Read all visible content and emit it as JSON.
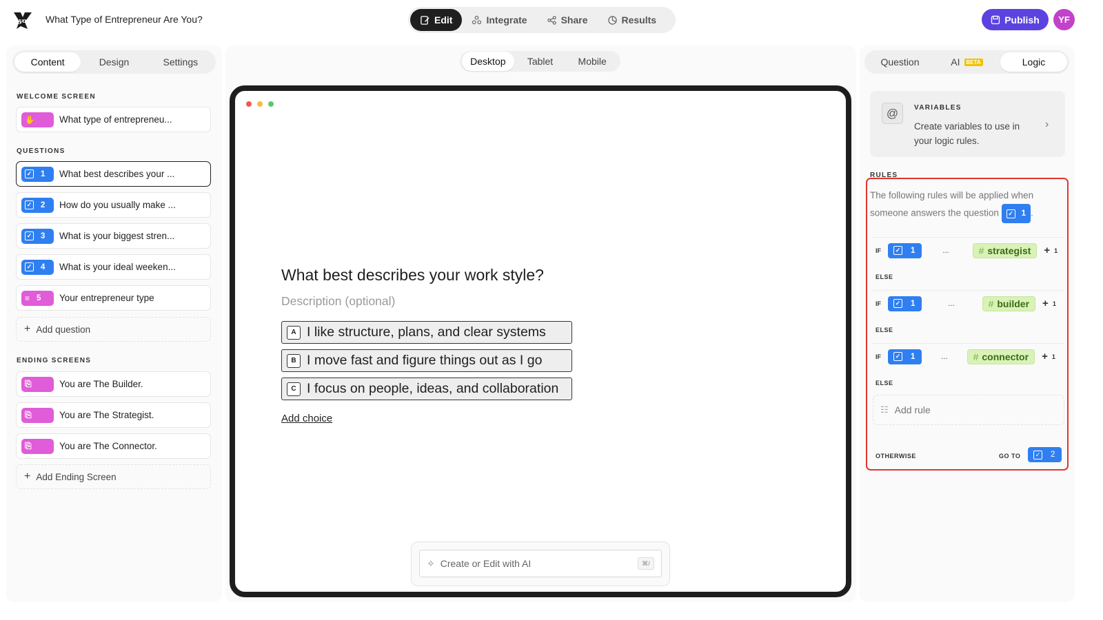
{
  "app": {
    "doc_title": "What Type of Entrepreneur Are You?",
    "logo": "logo-glyph"
  },
  "top_tabs": [
    {
      "label": "Edit",
      "icon": "edit-icon",
      "active": true
    },
    {
      "label": "Integrate",
      "icon": "integrate-icon",
      "active": false
    },
    {
      "label": "Share",
      "icon": "share-icon",
      "active": false
    },
    {
      "label": "Results",
      "icon": "results-icon",
      "active": false
    }
  ],
  "header_right": {
    "publish_label": "Publish",
    "avatar_initials": "YF"
  },
  "left": {
    "tabs": [
      "Content",
      "Design",
      "Settings"
    ],
    "active_tab": "Content",
    "welcome_label": "WELCOME SCREEN",
    "welcome_item": "What type of entrepreneu...",
    "questions_label": "QUESTIONS",
    "questions": [
      {
        "num": "1",
        "text": "What best describes your ...",
        "type": "checkbox"
      },
      {
        "num": "2",
        "text": "How do you usually make ...",
        "type": "checkbox"
      },
      {
        "num": "3",
        "text": "What is your biggest stren...",
        "type": "checkbox"
      },
      {
        "num": "4",
        "text": "What is your ideal weeken...",
        "type": "checkbox"
      },
      {
        "num": "5",
        "text": "Your entrepreneur type",
        "type": "statement"
      }
    ],
    "add_question": "Add question",
    "endings_label": "ENDING SCREENS",
    "endings": [
      {
        "text": "You are The Builder."
      },
      {
        "text": "You are The Strategist."
      },
      {
        "text": "You are The Connector."
      }
    ],
    "add_ending": "Add Ending Screen"
  },
  "center": {
    "device_tabs": [
      "Desktop",
      "Tablet",
      "Mobile"
    ],
    "active_device": "Desktop",
    "question_title": "What best describes your work style?",
    "description_placeholder": "Description (optional)",
    "choices": [
      {
        "key": "A",
        "text": "I like structure, plans, and clear systems"
      },
      {
        "key": "B",
        "text": "I move fast and figure things out as I go"
      },
      {
        "key": "C",
        "text": "I focus on people, ideas, and collaboration"
      }
    ],
    "add_choice": "Add choice",
    "ai_placeholder": "Create or Edit with AI",
    "ai_shortcut": "⌘/"
  },
  "right": {
    "tabs": [
      {
        "label": "Question"
      },
      {
        "label": "AI",
        "badge": "BETA"
      },
      {
        "label": "Logic"
      }
    ],
    "active_tab": "Logic",
    "variables_title": "VARIABLES",
    "variables_desc": "Create variables to use in your logic rules.",
    "rules_label": "RULES",
    "rules_intro": "The following rules will be applied when someone answers the question",
    "rules_intro_q": "1",
    "if_label": "IF",
    "else_label": "ELSE",
    "ellipsis": "...",
    "rules": [
      {
        "q": "1",
        "tag": "strategist",
        "add": "1"
      },
      {
        "q": "1",
        "tag": "builder",
        "add": "1"
      },
      {
        "q": "1",
        "tag": "connector",
        "add": "1"
      }
    ],
    "add_rule": "Add rule",
    "otherwise_label": "OTHERWISE",
    "goto_label": "GO TO",
    "goto_q": "2"
  },
  "colors": {
    "accent_blue": "#2f7ff0",
    "pink": "#e05cd8",
    "publish_purple": "#5b43e0",
    "highlight_red": "#e0352b",
    "tag_green": "#d9f2b8"
  }
}
